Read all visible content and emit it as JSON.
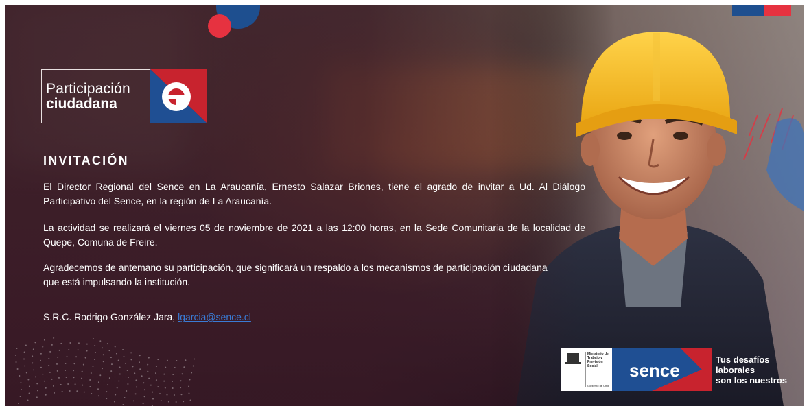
{
  "logo": {
    "line1": "Participación",
    "line2": "ciudadana"
  },
  "invitation": {
    "heading": "INVITACIÓN",
    "paragraph1": "El Director Regional del Sence en La Araucanía, Ernesto Salazar Briones, tiene el agrado de invitar a Ud. Al Diálogo Participativo del Sence, en la región de La Araucanía.",
    "paragraph2": "La actividad se realizará el viernes 05 de noviembre de 2021 a las 12:00 horas, en la Sede Comunitaria de la localidad de Quepe, Comuna de Freire.",
    "paragraph3": "Agradecemos de antemano su participación, que significará un respaldo a los mecanismos de participación ciudadana que está impulsando la institución.",
    "signature_prefix": "S.R.C. Rodrigo González Jara, ",
    "email": "lgarcia@sence.cl"
  },
  "footer": {
    "ministry_line1": "Ministerio del",
    "ministry_line2": "Trabajo y",
    "ministry_line3": "Previsión",
    "ministry_line4": "Social",
    "government": "Gobierno de Chile",
    "brand": "sence",
    "slogan_line1": "Tus desafíos",
    "slogan_line2": "laborales",
    "slogan_line3": "son los nuestros"
  },
  "colors": {
    "accent_red": "#e63240",
    "accent_blue": "#1e4f8f",
    "link": "#3a7bd5"
  }
}
